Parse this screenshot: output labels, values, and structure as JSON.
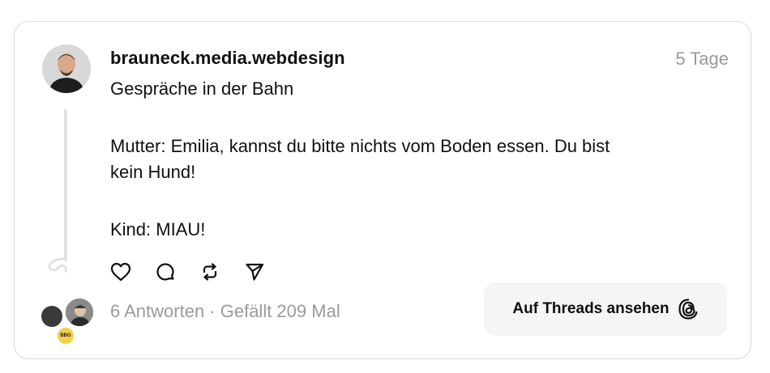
{
  "post": {
    "username": "brauneck.media.webdesign",
    "timestamp": "5 Tage",
    "lines": [
      "Gespräche in der Bahn",
      "Mutter: Emilia, kannst du bitte nichts vom Boden essen. Du bist",
      "kein Hund!",
      "Kind: MIAU!"
    ]
  },
  "actions": {
    "like_icon": "heart-icon",
    "comment_icon": "comment-icon",
    "repost_icon": "repost-icon",
    "share_icon": "send-icon"
  },
  "footer": {
    "stats": "6 Antworten · Gefällt 209 Mal",
    "badge_text": "BBG",
    "view_button_label": "Auf Threads ansehen",
    "view_button_icon": "threads-logo-icon"
  }
}
